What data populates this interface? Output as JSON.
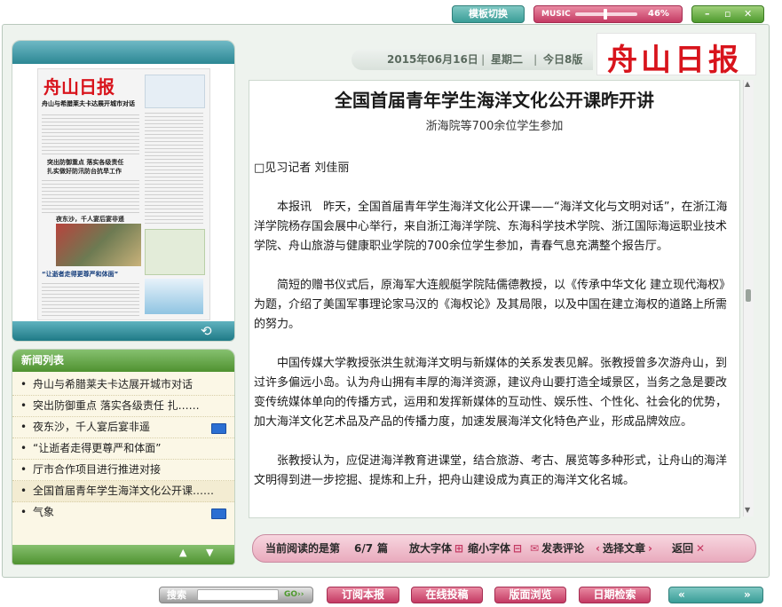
{
  "top": {
    "template_switch": "模板切换",
    "music_label": "MUSIC",
    "music_volume": "46%",
    "music_volume_fraction": 0.46
  },
  "header": {
    "date": "2015年06月16日",
    "weekday": "星期二",
    "pages": "今日8版",
    "logo_text": "舟山日报"
  },
  "thumbnail": {
    "masthead": "舟山日报",
    "headlines": [
      "舟山与希腊莱夫卡达展开城市对话",
      "突出防御重点 落实各级责任",
      "扎实做好防汛防台抗旱工作",
      "夜东沙，千人宴后宴非遥",
      "“让逝者走得更尊严和体面”"
    ]
  },
  "news_list": {
    "title": "新闻列表",
    "items": [
      {
        "text": "舟山与希腊莱夫卡达展开城市对话",
        "video": false
      },
      {
        "text": "突出防御重点 落实各级责任 扎……",
        "video": false
      },
      {
        "text": "夜东沙，千人宴后宴非遥",
        "video": true
      },
      {
        "text": "“让逝者走得更尊严和体面”",
        "video": false
      },
      {
        "text": "厅市合作项目进行推进对接",
        "video": false
      },
      {
        "text": "全国首届青年学生海洋文化公开课……",
        "video": false
      },
      {
        "text": "气象",
        "video": true
      }
    ]
  },
  "article": {
    "title": "全国首届青年学生海洋文化公开课昨开讲",
    "subtitle": "浙海院等700余位学生参加",
    "byline": "□见习记者 刘佳丽",
    "paragraphs": [
      "本报讯　昨天，全国首届青年学生海洋文化公开课——“海洋文化与文明对话”，在浙江海洋学院杨存国会展中心举行，来自浙江海洋学院、东海科学技术学院、浙江国际海运职业技术学院、舟山旅游与健康职业学院的700余位学生参加，青春气息充满整个报告厅。",
      "简短的赠书仪式后，原海军大连舰艇学院陆儒德教授，以《传承中华文化 建立现代海权》为题，介绍了美国军事理论家马汉的《海权论》及其局限，以及中国在建立海权的道路上所需的努力。",
      "中国传媒大学教授张洪生就海洋文明与新媒体的关系发表见解。张教授曾多次游舟山，到过许多偏远小岛。认为舟山拥有丰厚的海洋资源，建议舟山要打造全域景区，当务之急是要改变传统媒体单向的传播方式，运用和发挥新媒体的互动性、娱乐性、个性化、社会化的优势，加大海洋文化艺术品及产品的传播力度，加速发展海洋文化特色产业，形成品牌效应。",
      "张教授认为，应促进海洋教育进课堂，结合旅游、考古、展览等多种形式，让舟山的海洋文明得到进一步挖掘、提炼和上升，把舟山建设成为真正的海洋文化名城。"
    ]
  },
  "reading_bar": {
    "current_label": "当前阅读的是第",
    "position": "6/7",
    "unit": "篇",
    "enlarge": "放大字体",
    "shrink": "缩小字体",
    "comment": "发表评论",
    "choose": "选择文章",
    "back": "返回"
  },
  "bottom": {
    "search_label": "搜索",
    "search_placeholder": "",
    "go": "GO",
    "subscribe": "订阅本报",
    "submit": "在线投稿",
    "browse": "版面浏览",
    "date_search": "日期检索"
  },
  "colors": {
    "teal": "#3a9d97",
    "pink": "#c43a63",
    "green": "#4f9230",
    "logo_red": "#d8141c"
  }
}
